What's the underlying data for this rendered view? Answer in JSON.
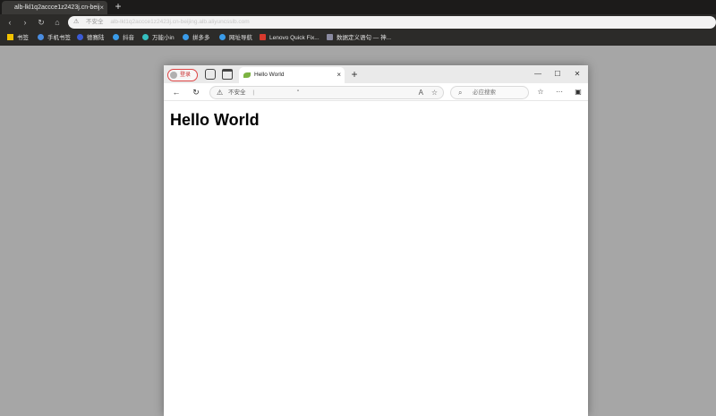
{
  "outer_browser": {
    "tab_title": "alb-lkl1q2accce1z2423j.cn-beij",
    "tab_close": "×",
    "new_tab": "+",
    "nav_back": "‹",
    "nav_forward": "›",
    "nav_reload": "↻",
    "nav_home": "⌂",
    "address_warning": "⚠",
    "address_insecure": "不安全",
    "address_url": "alb-lkl1q2accce1z2423j.cn-beijing.alb.aliyuncsslb.com",
    "bookmarks": [
      {
        "label": "书签",
        "color": "#f2c200"
      },
      {
        "label": "手机书签",
        "color": "#4a8de0"
      },
      {
        "label": "德赛陆",
        "color": "#3b5bd6"
      },
      {
        "label": "抖音",
        "color": "#3a9be8"
      },
      {
        "label": "万能小in",
        "color": "#35c0c0"
      },
      {
        "label": "拼多多",
        "color": "#3a9be8"
      },
      {
        "label": "网址导航",
        "color": "#3a9be8"
      },
      {
        "label": "Lenovo Quick Fix...",
        "color": "#d83a2e"
      },
      {
        "label": "数据定义语句 — 神...",
        "color": "#8a8aa0"
      }
    ]
  },
  "inner_browser": {
    "profile_label": "登录",
    "tab_title": "Hello World",
    "tab_close": "×",
    "new_tab": "+",
    "window_minimize": "—",
    "window_maximize": "☐",
    "window_close": "✕",
    "nav_back": "←",
    "nav_reload": "↻",
    "address_warning": "⚠",
    "address_insecure": "不安全",
    "address_sep": "|",
    "address_text": "\"",
    "read_aloud": "A",
    "favorite": "☆",
    "search_icon": "⌕",
    "search_placeholder": "必应搜索",
    "favorites_bar": "☆",
    "more": "···",
    "sidebar": "▣"
  },
  "page": {
    "heading": "Hello World"
  },
  "colors": {
    "desktop_bg": "#a6a6a6",
    "outer_chrome": "#2c2b29",
    "inner_tabbar": "#eaeaea",
    "profile_border": "#dd4444"
  }
}
